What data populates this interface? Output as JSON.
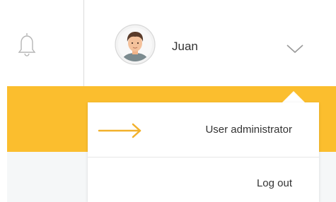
{
  "header": {
    "user_name": "Juan"
  },
  "icons": {
    "notifications": "bell-icon",
    "user_menu": "chevron-down-icon",
    "avatar": "user-avatar",
    "pointer": "arrow-right-icon"
  },
  "menu": {
    "items": [
      {
        "label": "User administrator"
      },
      {
        "label": "Log out"
      }
    ]
  },
  "colors": {
    "accent": "#fbbe2e",
    "arrow": "#f2b12b",
    "text": "#333333"
  }
}
